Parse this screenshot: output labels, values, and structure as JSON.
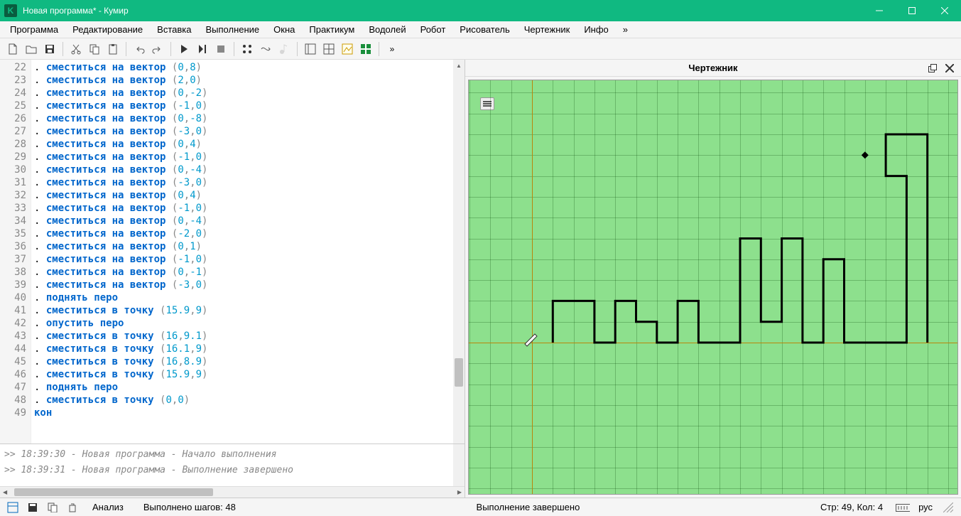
{
  "window": {
    "title": "Новая программа* - Кумир",
    "app_icon_letter": "K"
  },
  "menu": {
    "items": [
      "Программа",
      "Редактирование",
      "Вставка",
      "Выполнение",
      "Окна",
      "Практикум",
      "Водолей",
      "Робот",
      "Рисователь",
      "Чертежник",
      "Инфо",
      "»"
    ]
  },
  "toolbar": {
    "overflow": "»"
  },
  "editor": {
    "first_line": 22,
    "lines": [
      {
        "type": "cmd",
        "cmd": "сместиться на вектор",
        "args": [
          "0",
          "8"
        ]
      },
      {
        "type": "cmd",
        "cmd": "сместиться на вектор",
        "args": [
          "2",
          "0"
        ]
      },
      {
        "type": "cmd",
        "cmd": "сместиться на вектор",
        "args": [
          "0",
          "-2"
        ]
      },
      {
        "type": "cmd",
        "cmd": "сместиться на вектор",
        "args": [
          "-1",
          "0"
        ]
      },
      {
        "type": "cmd",
        "cmd": "сместиться на вектор",
        "args": [
          "0",
          "-8"
        ]
      },
      {
        "type": "cmd",
        "cmd": "сместиться на вектор",
        "args": [
          "-3",
          "0"
        ]
      },
      {
        "type": "cmd",
        "cmd": "сместиться на вектор",
        "args": [
          "0",
          "4"
        ]
      },
      {
        "type": "cmd",
        "cmd": "сместиться на вектор",
        "args": [
          "-1",
          "0"
        ]
      },
      {
        "type": "cmd",
        "cmd": "сместиться на вектор",
        "args": [
          "0",
          "-4"
        ]
      },
      {
        "type": "cmd",
        "cmd": "сместиться на вектор",
        "args": [
          "-3",
          "0"
        ]
      },
      {
        "type": "cmd",
        "cmd": "сместиться на вектор",
        "args": [
          "0",
          "4"
        ]
      },
      {
        "type": "cmd",
        "cmd": "сместиться на вектор",
        "args": [
          "-1",
          "0"
        ]
      },
      {
        "type": "cmd",
        "cmd": "сместиться на вектор",
        "args": [
          "0",
          "-4"
        ]
      },
      {
        "type": "cmd",
        "cmd": "сместиться на вектор",
        "args": [
          "-2",
          "0"
        ]
      },
      {
        "type": "cmd",
        "cmd": "сместиться на вектор",
        "args": [
          "0",
          "1"
        ]
      },
      {
        "type": "cmd",
        "cmd": "сместиться на вектор",
        "args": [
          "-1",
          "0"
        ]
      },
      {
        "type": "cmd",
        "cmd": "сместиться на вектор",
        "args": [
          "0",
          "-1"
        ]
      },
      {
        "type": "cmd",
        "cmd": "сместиться на вектор",
        "args": [
          "-3",
          "0"
        ]
      },
      {
        "type": "plain",
        "cmd": "поднять перо"
      },
      {
        "type": "cmd",
        "cmd": "сместиться в точку",
        "args": [
          "15.9",
          "9"
        ]
      },
      {
        "type": "plain",
        "cmd": "опустить перо"
      },
      {
        "type": "cmd",
        "cmd": "сместиться в точку",
        "args": [
          "16",
          "9.1"
        ]
      },
      {
        "type": "cmd",
        "cmd": "сместиться в точку",
        "args": [
          "16.1",
          "9"
        ]
      },
      {
        "type": "cmd",
        "cmd": "сместиться в точку",
        "args": [
          "16",
          "8.9"
        ]
      },
      {
        "type": "cmd",
        "cmd": "сместиться в точку",
        "args": [
          "15.9",
          "9"
        ]
      },
      {
        "type": "plain",
        "cmd": "поднять перо"
      },
      {
        "type": "cmd",
        "cmd": "сместиться в точку",
        "args": [
          "0",
          "0"
        ]
      },
      {
        "type": "raw",
        "text": "кон"
      }
    ]
  },
  "console": {
    "lines": [
      ">> 18:39:30 - Новая программа - Начало выполнения",
      ">> 18:39:31 - Новая программа - Выполнение завершено"
    ]
  },
  "drawer": {
    "title": "Чертежник"
  },
  "status": {
    "analysis": "Анализ",
    "steps": "Выполнено шагов: 48",
    "state": "Выполнение завершено",
    "cursor": "Стр: 49, Кол: 4",
    "lang": "рус"
  },
  "colors": {
    "accent": "#10b981",
    "kw": "#0066cc",
    "num": "#0099cc"
  }
}
